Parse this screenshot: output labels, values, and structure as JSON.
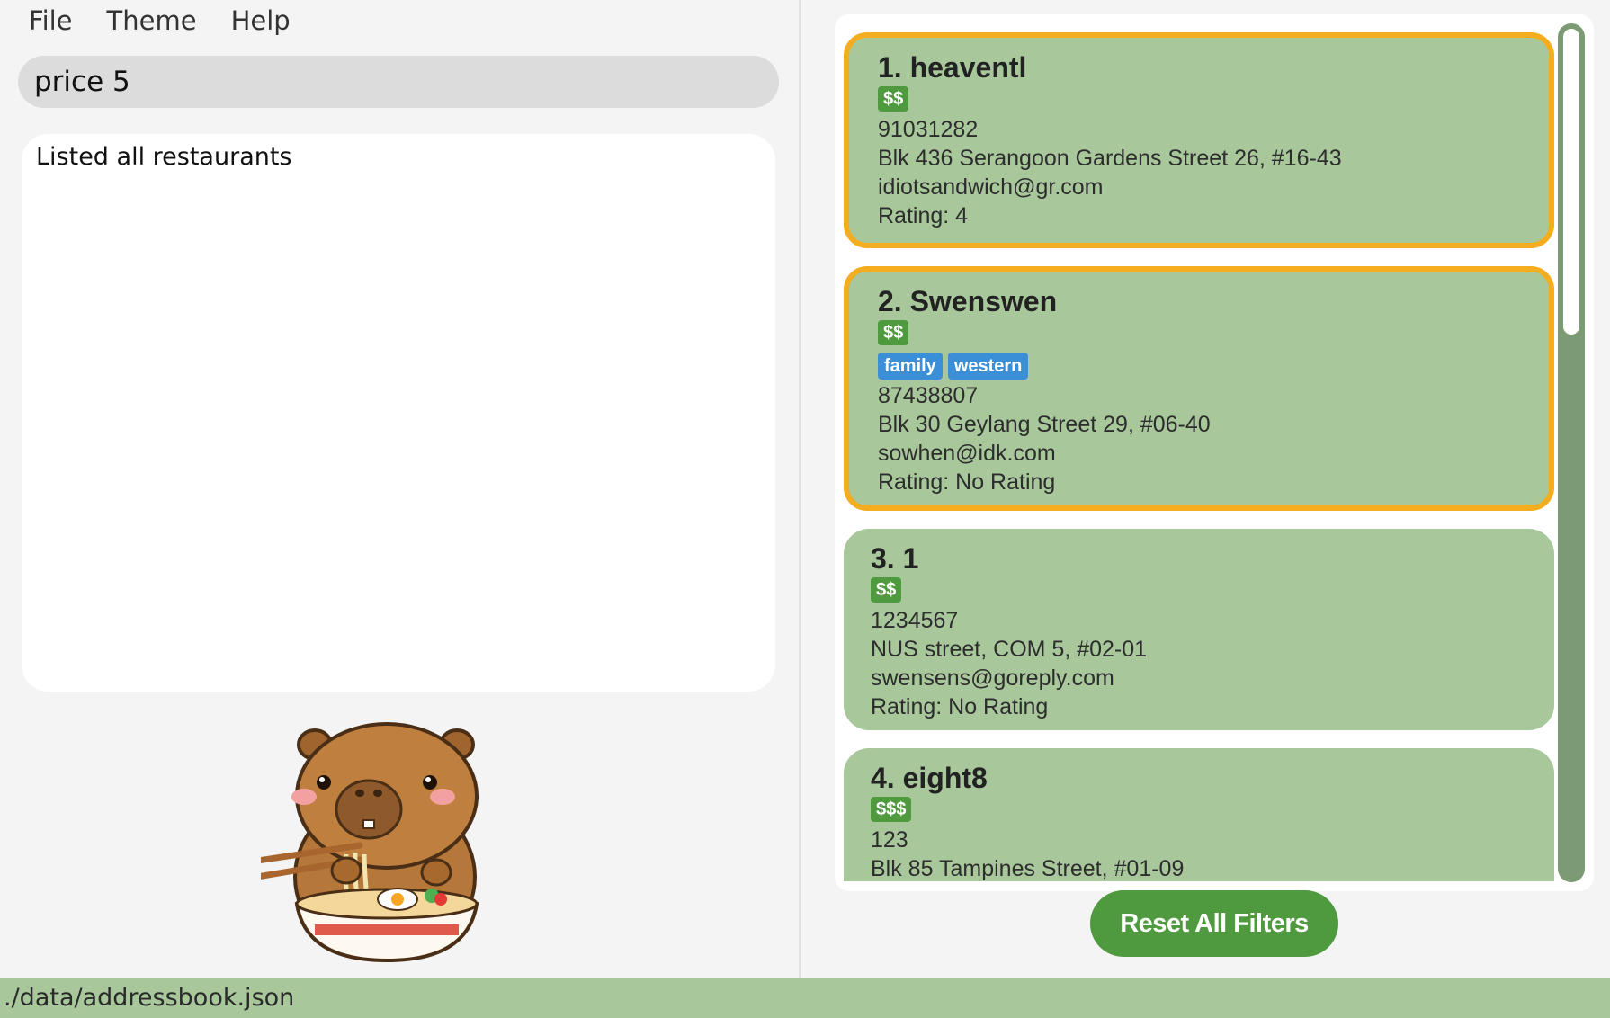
{
  "menu": {
    "file": "File",
    "theme": "Theme",
    "help": "Help"
  },
  "command": {
    "value": "price 5"
  },
  "result": {
    "message": "Listed all restaurants"
  },
  "restaurants": [
    {
      "index_name": "1. heaventl",
      "price": "$$",
      "tags": [],
      "phone": "91031282",
      "address": "Blk 436 Serangoon Gardens Street 26, #16-43",
      "email": "idiotsandwich@gr.com",
      "rating": "Rating: 4",
      "selected": true
    },
    {
      "index_name": "2. Swenswen",
      "price": "$$",
      "tags": [
        "family",
        "western"
      ],
      "phone": "87438807",
      "address": "Blk 30 Geylang Street 29, #06-40",
      "email": "sowhen@idk.com",
      "rating": "Rating: No Rating",
      "selected": true
    },
    {
      "index_name": "3. 1",
      "price": "$$",
      "tags": [],
      "phone": "1234567",
      "address": "NUS street, COM 5, #02-01",
      "email": "swensens@goreply.com",
      "rating": "Rating: No Rating",
      "selected": false
    },
    {
      "index_name": "4. eight8",
      "price": "$$$",
      "tags": [],
      "phone": "123",
      "address": "Blk 85 Tampines Street, #01-09",
      "selected": false
    }
  ],
  "reset_button": {
    "label": "Reset All Filters"
  },
  "status": {
    "path": "./data/addressbook.json"
  },
  "colors": {
    "card_bg": "#a8c89c",
    "selected_border": "#f4ad1e",
    "price_tag": "#4f9a3e",
    "category_tag": "#3b8fd6",
    "scrollbar": "#7c9a73",
    "status_bar": "#a8c89c"
  },
  "icons": {
    "mascot": "capybara-eating-ramen-mascot"
  }
}
